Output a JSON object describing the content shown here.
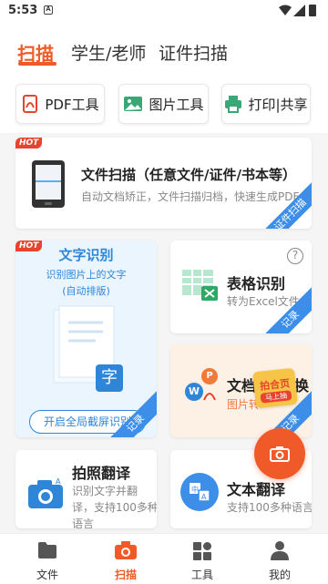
{
  "status": {
    "time": "5:53",
    "notif_glyph": "A"
  },
  "tabs": [
    "扫描",
    "学生/老师",
    "证件扫描"
  ],
  "tools": [
    "PDF工具",
    "图片工具",
    "打印|共享"
  ],
  "hot_label": "HOT",
  "doc_scan": {
    "title": "文件扫描（任意文件/证件/书本等）",
    "subtitle": "自动文档矫正，文件扫描归档，快速生成PDF",
    "ribbon": "证件扫描"
  },
  "ocr": {
    "title": "文字识别",
    "line1": "识别图片上的文字",
    "line2": "(自动排版)",
    "char": "字",
    "button": "开启全局截屏识别",
    "ribbon": "记录"
  },
  "table_ocr": {
    "title": "表格识别",
    "subtitle": "转为Excel文件",
    "help": "?",
    "ribbon": "记录"
  },
  "doc_convert": {
    "title": "文档",
    "title_tail": "换",
    "subtitle": "图片转",
    "promo_main": "拍合页",
    "promo_small": "马上抽",
    "ribbon": "记录",
    "badge_w": "W",
    "badge_p": "P"
  },
  "photo_translate": {
    "title": "拍照翻译",
    "line1": "识别文字并翻",
    "line2": "译，支持100多种",
    "line3": "语言"
  },
  "text_translate": {
    "title": "文本翻译",
    "subtitle": "支持100多种语言"
  },
  "nav": [
    "文件",
    "扫描",
    "工具",
    "我的"
  ],
  "colors": {
    "accent": "#f05a28",
    "ribbon": "#3d8ee8",
    "hot": "#e8432f"
  }
}
